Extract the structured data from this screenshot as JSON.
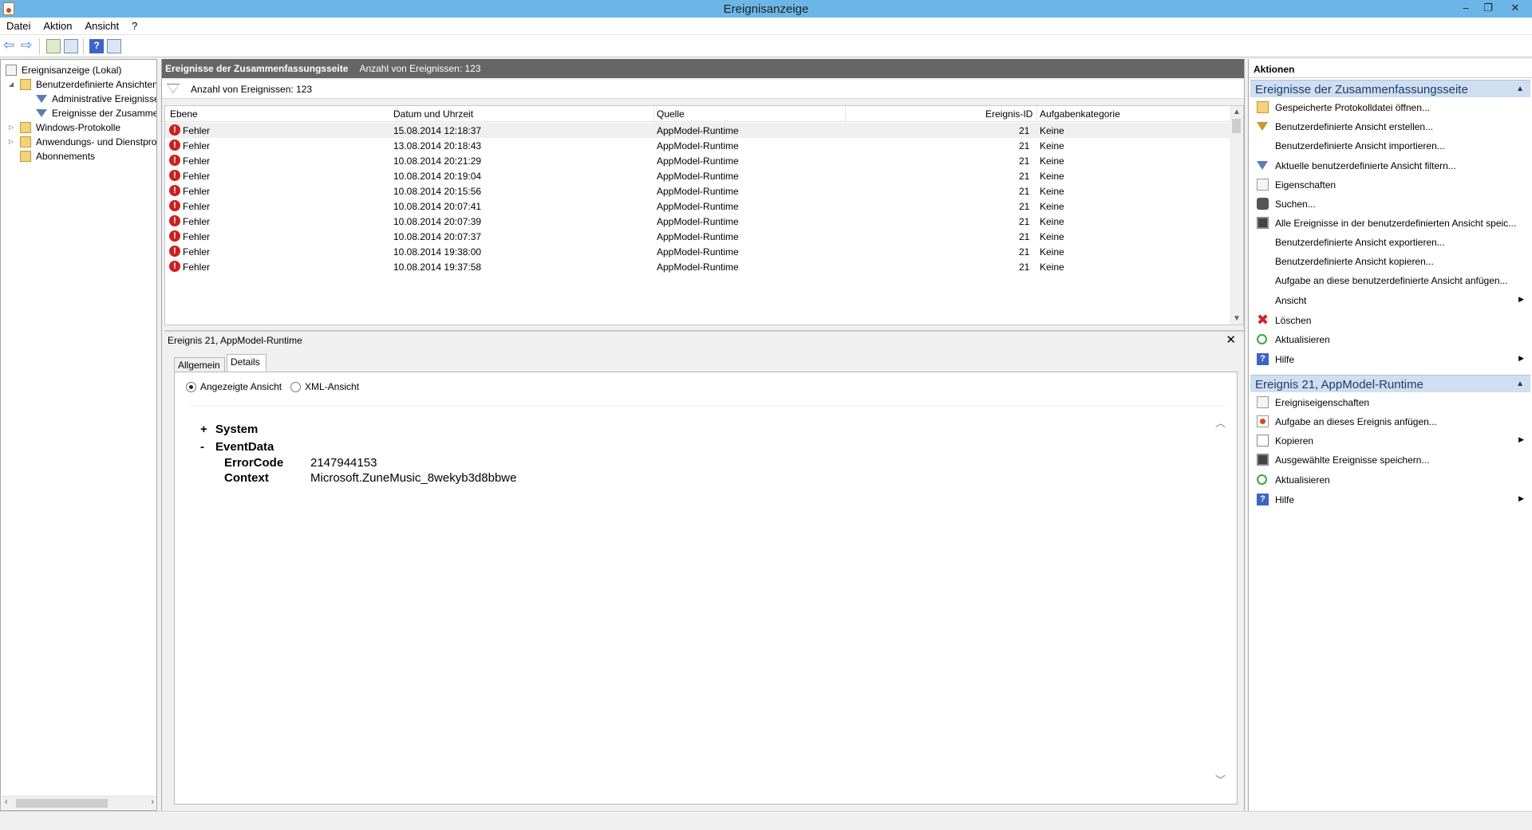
{
  "window": {
    "title": "Ereignisanzeige",
    "min_glyph": "–",
    "max_glyph": "❐",
    "close_glyph": "✕"
  },
  "menu": [
    "Datei",
    "Aktion",
    "Ansicht",
    "?"
  ],
  "toolbar": {
    "back_glyph": "⇦",
    "forward_glyph": "⇨",
    "help_glyph": "?"
  },
  "tree": {
    "items": [
      {
        "label": "Ereignisanzeige (Lokal)",
        "icon": "computer-icon",
        "level": 0,
        "expander": ""
      },
      {
        "label": "Benutzerdefinierte Ansichten",
        "icon": "folder-icon",
        "level": 1,
        "expander": "◢"
      },
      {
        "label": "Administrative Ereignisse",
        "icon": "filter-icon",
        "level": 2,
        "expander": ""
      },
      {
        "label": "Ereignisse der Zusammenfassungsseite",
        "icon": "filter-icon",
        "level": 2,
        "expander": ""
      },
      {
        "label": "Windows-Protokolle",
        "icon": "folder-icon",
        "level": 1,
        "expander": "▷"
      },
      {
        "label": "Anwendungs- und Dienstprotokolle",
        "icon": "folder-icon",
        "level": 1,
        "expander": "▷"
      },
      {
        "label": "Abonnements",
        "icon": "folder-icon",
        "level": 1,
        "expander": ""
      }
    ],
    "scroll_left": "‹",
    "scroll_right": "›"
  },
  "center": {
    "header_title": "Ereignisse der Zusammenfassungsseite",
    "header_count": "Anzahl von Ereignissen: 123",
    "filter_text": "Anzahl von Ereignissen: 123",
    "columns": [
      "Ebene",
      "Datum und Uhrzeit",
      "Quelle",
      "Ereignis-ID",
      "Aufgabenkategorie"
    ],
    "rows": [
      {
        "level": "Fehler",
        "date": "15.08.2014 12:18:37",
        "source": "AppModel-Runtime",
        "id": "21",
        "category": "Keine"
      },
      {
        "level": "Fehler",
        "date": "13.08.2014 20:18:43",
        "source": "AppModel-Runtime",
        "id": "21",
        "category": "Keine"
      },
      {
        "level": "Fehler",
        "date": "10.08.2014 20:21:29",
        "source": "AppModel-Runtime",
        "id": "21",
        "category": "Keine"
      },
      {
        "level": "Fehler",
        "date": "10.08.2014 20:19:04",
        "source": "AppModel-Runtime",
        "id": "21",
        "category": "Keine"
      },
      {
        "level": "Fehler",
        "date": "10.08.2014 20:15:56",
        "source": "AppModel-Runtime",
        "id": "21",
        "category": "Keine"
      },
      {
        "level": "Fehler",
        "date": "10.08.2014 20:07:41",
        "source": "AppModel-Runtime",
        "id": "21",
        "category": "Keine"
      },
      {
        "level": "Fehler",
        "date": "10.08.2014 20:07:39",
        "source": "AppModel-Runtime",
        "id": "21",
        "category": "Keine"
      },
      {
        "level": "Fehler",
        "date": "10.08.2014 20:07:37",
        "source": "AppModel-Runtime",
        "id": "21",
        "category": "Keine"
      },
      {
        "level": "Fehler",
        "date": "10.08.2014 19:38:00",
        "source": "AppModel-Runtime",
        "id": "21",
        "category": "Keine"
      },
      {
        "level": "Fehler",
        "date": "10.08.2014 19:37:58",
        "source": "AppModel-Runtime",
        "id": "21",
        "category": "Keine"
      }
    ],
    "error_glyph": "!",
    "scroll_up": "▲",
    "scroll_down": "▼"
  },
  "detail": {
    "title": "Ereignis 21, AppModel-Runtime",
    "close_glyph": "✕",
    "tabs": [
      "Allgemein",
      "Details"
    ],
    "active_tab": "Details",
    "view_options": [
      "Angezeigte Ansicht",
      "XML-Ansicht"
    ],
    "selected_view": "Angezeigte Ansicht",
    "nodes": [
      {
        "toggle": "+",
        "name": "System"
      },
      {
        "toggle": "-",
        "name": "EventData"
      }
    ],
    "fields": [
      {
        "name": "ErrorCode",
        "value": "2147944153"
      },
      {
        "name": "Context",
        "value": "Microsoft.ZuneMusic_8wekyb3d8bbwe"
      }
    ],
    "scroll_up": "︿",
    "scroll_down": "﹀"
  },
  "actions": {
    "header": "Aktionen",
    "section1": {
      "title": "Ereignisse der Zusammenfassungsseite",
      "items": [
        {
          "label": "Gespeicherte Protokolldatei öffnen...",
          "icon": "open-log-icon",
          "submenu": false
        },
        {
          "label": "Benutzerdefinierte Ansicht erstellen...",
          "icon": "create-view-icon",
          "submenu": false
        },
        {
          "label": "Benutzerdefinierte Ansicht importieren...",
          "icon": "",
          "submenu": false
        },
        {
          "label": "Aktuelle benutzerdefinierte Ansicht filtern...",
          "icon": "filter-icon",
          "submenu": false
        },
        {
          "label": "Eigenschaften",
          "icon": "properties-icon",
          "submenu": false
        },
        {
          "label": "Suchen...",
          "icon": "find-icon",
          "submenu": false
        },
        {
          "label": "Alle Ereignisse in der benutzerdefinierten Ansicht speic...",
          "icon": "save-icon",
          "submenu": false
        },
        {
          "label": "Benutzerdefinierte Ansicht exportieren...",
          "icon": "",
          "submenu": false
        },
        {
          "label": "Benutzerdefinierte Ansicht kopieren...",
          "icon": "",
          "submenu": false
        },
        {
          "label": "Aufgabe an diese benutzerdefinierte Ansicht anfügen...",
          "icon": "",
          "submenu": false
        },
        {
          "label": "Ansicht",
          "icon": "",
          "submenu": true
        },
        {
          "label": "Löschen",
          "icon": "delete-icon",
          "submenu": false
        },
        {
          "label": "Aktualisieren",
          "icon": "refresh-icon",
          "submenu": false
        },
        {
          "label": "Hilfe",
          "icon": "help-icon",
          "submenu": true
        }
      ]
    },
    "section2": {
      "title": "Ereignis 21, AppModel-Runtime",
      "items": [
        {
          "label": "Ereigniseigenschaften",
          "icon": "properties-icon",
          "submenu": false
        },
        {
          "label": "Aufgabe an dieses Ereignis anfügen...",
          "icon": "attach-task-icon",
          "submenu": false
        },
        {
          "label": "Kopieren",
          "icon": "copy-icon",
          "submenu": true
        },
        {
          "label": "Ausgewählte Ereignisse speichern...",
          "icon": "save-icon",
          "submenu": false
        },
        {
          "label": "Aktualisieren",
          "icon": "refresh-icon",
          "submenu": false
        },
        {
          "label": "Hilfe",
          "icon": "help-icon",
          "submenu": true
        }
      ]
    },
    "collapse_glyph": "▲",
    "submenu_glyph": "▶",
    "delete_glyph": "✖",
    "help_glyph": "?"
  }
}
